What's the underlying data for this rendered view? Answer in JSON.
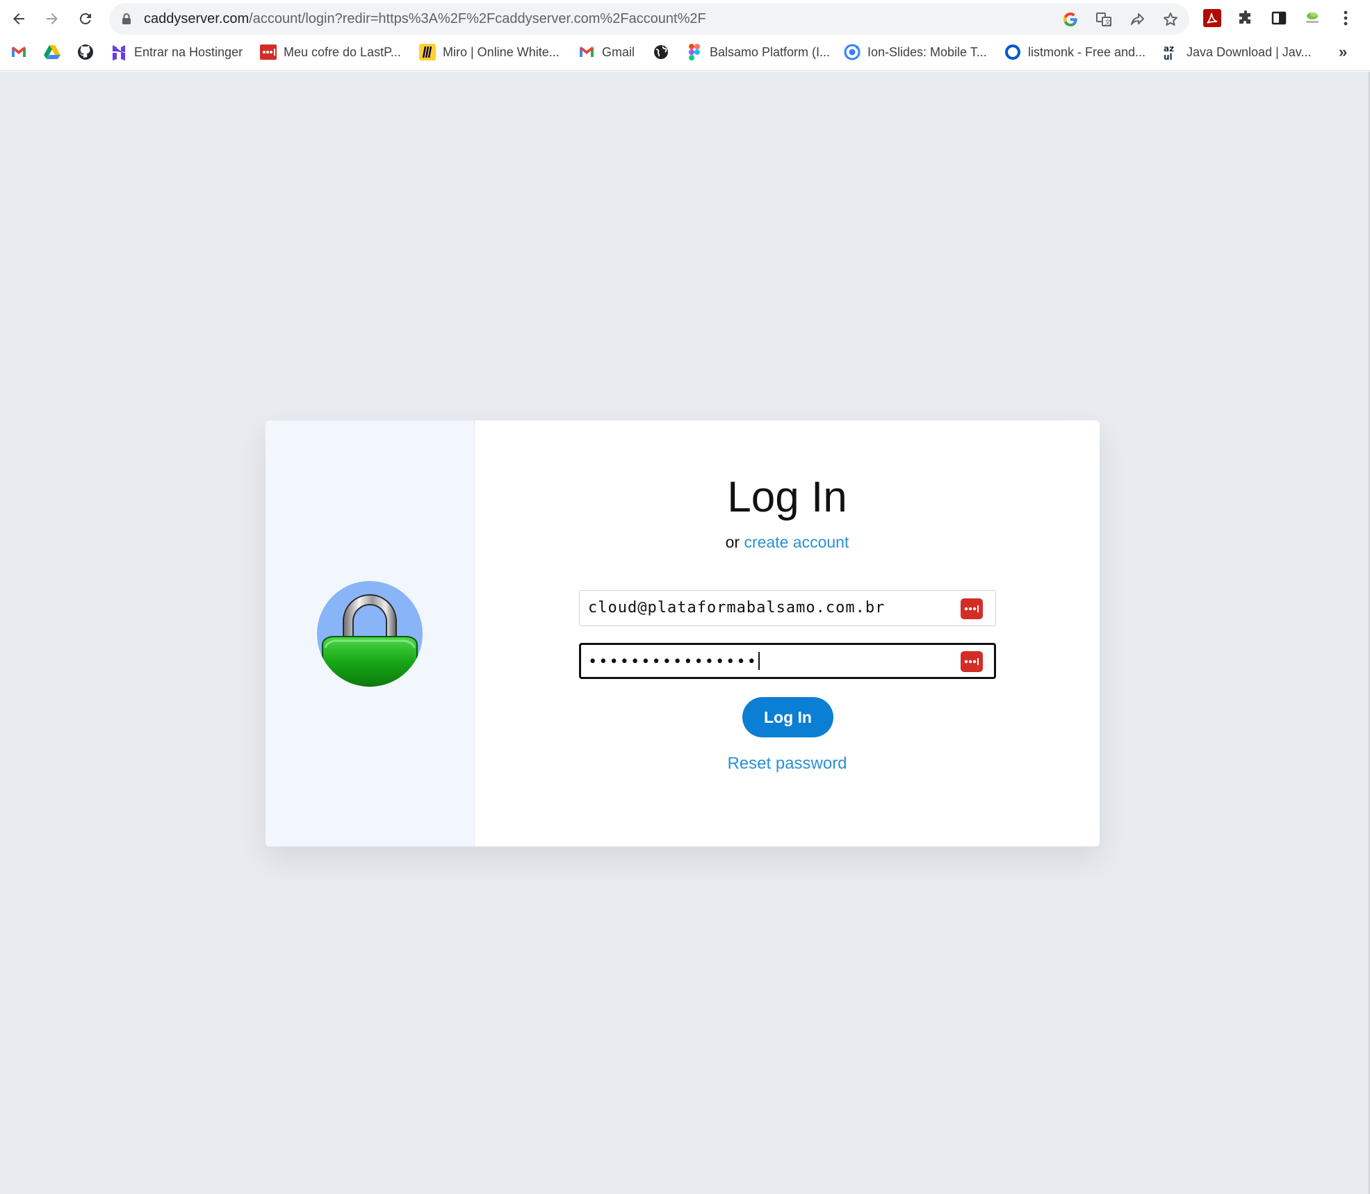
{
  "browser": {
    "url_host": "caddyserver.com",
    "url_path": "/account/login?redir=https%3A%2F%2Fcaddyserver.com%2Faccount%2F",
    "bookmarks": [
      {
        "label": "",
        "icon": "gmail-icon"
      },
      {
        "label": "",
        "icon": "google-drive-icon"
      },
      {
        "label": "",
        "icon": "github-icon"
      },
      {
        "label": "Entrar na Hostinger",
        "icon": "hostinger-icon"
      },
      {
        "label": "Meu cofre do LastP...",
        "icon": "lastpass-icon"
      },
      {
        "label": "Miro | Online White...",
        "icon": "miro-icon"
      },
      {
        "label": "Gmail",
        "icon": "gmail-icon"
      },
      {
        "label": "",
        "icon": "globe-icon"
      },
      {
        "label": "Balsamo Platform (I...",
        "icon": "figma-icon"
      },
      {
        "label": "Ion-Slides: Mobile T...",
        "icon": "ionic-icon"
      },
      {
        "label": "listmonk - Free and...",
        "icon": "listmonk-icon"
      },
      {
        "label": "Java Download | Jav...",
        "icon": "azul-icon"
      }
    ],
    "overflow_label": "»"
  },
  "login": {
    "title": "Log In",
    "subtitle_prefix": "or",
    "create_account_label": "create account",
    "email_value": "cloud@plataformabalsamo.com.br",
    "password_value": "••••••••••••••••",
    "submit_label": "Log In",
    "reset_label": "Reset password"
  },
  "colors": {
    "accent": "#0b7fd4",
    "link": "#2b8fd6",
    "page_bg": "#e7eaee",
    "side_bg": "#f2f7fe",
    "lastpass_red": "#d32d27"
  }
}
